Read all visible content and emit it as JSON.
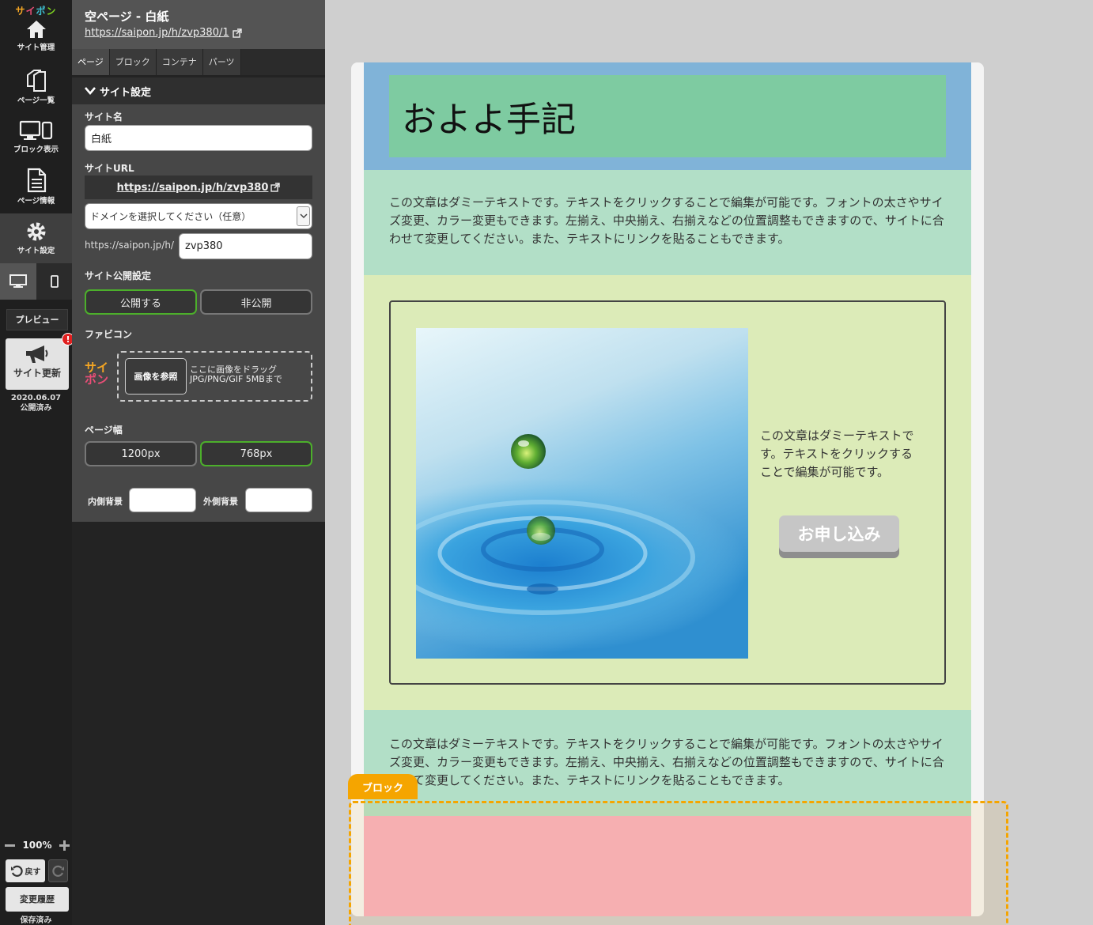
{
  "brand": {
    "chars": [
      "サ",
      "イ",
      "ポ",
      "ン"
    ]
  },
  "rail": {
    "items": [
      {
        "label": "サイト管理",
        "icon": "home-icon"
      },
      {
        "label": "ページ一覧",
        "icon": "pages-icon"
      },
      {
        "label": "ブロック表示",
        "icon": "devices-icon"
      },
      {
        "label": "ページ情報",
        "icon": "document-icon"
      },
      {
        "label": "サイト設定",
        "icon": "gear-icon"
      }
    ],
    "preview_label": "プレビュー",
    "update_label": "サイト更新",
    "update_badge": "!",
    "update_date": "2020.06.07",
    "update_status": "公開済み",
    "zoom": "100%",
    "undo_label": "戻す",
    "history_label": "変更履歴",
    "saved_label": "保存済み"
  },
  "panel": {
    "title": "空ページ - 白紙",
    "url": "https://saipon.jp/h/zvp380/1",
    "tabs": [
      "ページ",
      "ブロック",
      "コンテナ",
      "パーツ"
    ],
    "section_title": "サイト設定",
    "site_name_label": "サイト名",
    "site_name_value": "白紙",
    "site_url_label": "サイトURL",
    "site_url": "https://saipon.jp/h/zvp380",
    "domain_placeholder": "ドメインを選択してください（任意）",
    "url_prefix": "https://saipon.jp/h/",
    "url_slug": "zvp380",
    "publish_label": "サイト公開設定",
    "publish_on": "公開する",
    "publish_off": "非公開",
    "favicon_label": "ファビコン",
    "favicon_logo": [
      "サイ",
      "ポン"
    ],
    "browse_label": "画像を参照",
    "drop_hint_1": "ここに画像をドラッグ",
    "drop_hint_2": "JPG/PNG/GIF 5MBまで",
    "page_width_label": "ページ幅",
    "width_1200": "1200px",
    "width_768": "768px",
    "inner_bg_label": "内側背景",
    "outer_bg_label": "外側背景"
  },
  "preview": {
    "heading": "およよ手記",
    "body_text": "この文章はダミーテキストです。テキストをクリックすることで編集が可能です。フォントの太さやサイズ変更、カラー変更もできます。左揃え、中央揃え、右揃えなどの位置調整もできますので、サイトに合わせて変更してください。また、テキストにリンクを貼ることもできます。",
    "side_text": "この文章はダミーテキストです。テキストをクリックすることで編集が可能です。",
    "button_label": "お申し込み",
    "block_tag": "ブロック"
  },
  "colors": {
    "header_bg": "#80b3d8",
    "header_card": "#7ecba1",
    "text_block": "#b2dfc7",
    "media_block": "#dcebb8",
    "pink_block": "#f7b0c1",
    "selected_outline": "#f5a500",
    "selected_button": "#4caf2b"
  }
}
